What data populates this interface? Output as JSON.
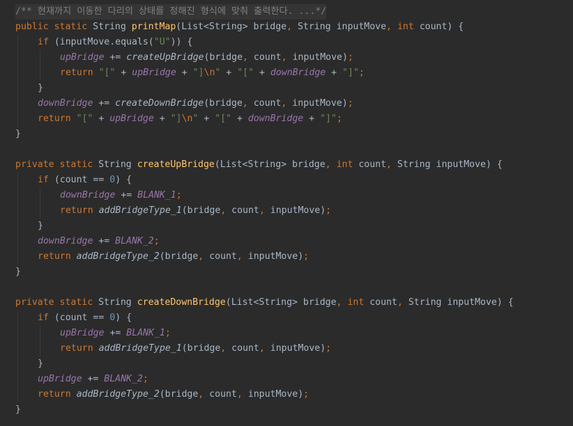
{
  "editor": {
    "language": "java",
    "colors": {
      "background": "#2b2b2b",
      "keyword": "#cc7832",
      "method_declaration": "#ffc66d",
      "field": "#9876aa",
      "string": "#6a8759",
      "number": "#6897bb",
      "comment": "#808080",
      "plain": "#a9b7c6"
    },
    "lines": [
      {
        "indent": 0,
        "tokens": [
          {
            "t": "/** 현재까지 이동한 다리의 상태를 정해진 형식에 맞춰 출력한다. ...*/",
            "c": "cm"
          }
        ]
      },
      {
        "indent": 0,
        "tokens": [
          {
            "t": "public",
            "c": "kw"
          },
          {
            "t": " ",
            "c": "plain"
          },
          {
            "t": "static",
            "c": "kw"
          },
          {
            "t": " String ",
            "c": "plain"
          },
          {
            "t": "printMap",
            "c": "fn"
          },
          {
            "t": "(List<String> bridge",
            "c": "plain"
          },
          {
            "t": ",",
            "c": "kw"
          },
          {
            "t": " String inputMove",
            "c": "plain"
          },
          {
            "t": ",",
            "c": "kw"
          },
          {
            "t": " ",
            "c": "plain"
          },
          {
            "t": "int",
            "c": "kw"
          },
          {
            "t": " count) {",
            "c": "plain"
          }
        ]
      },
      {
        "indent": 1,
        "tokens": [
          {
            "t": "if",
            "c": "kw"
          },
          {
            "t": " (inputMove.equals(",
            "c": "plain"
          },
          {
            "t": "\"U\"",
            "c": "str"
          },
          {
            "t": ")) {",
            "c": "plain"
          }
        ]
      },
      {
        "indent": 2,
        "tokens": [
          {
            "t": "upBridge",
            "c": "field"
          },
          {
            "t": " += ",
            "c": "plain"
          },
          {
            "t": "createUpBridge",
            "c": "call"
          },
          {
            "t": "(bridge",
            "c": "plain"
          },
          {
            "t": ",",
            "c": "kw"
          },
          {
            "t": " count",
            "c": "plain"
          },
          {
            "t": ",",
            "c": "kw"
          },
          {
            "t": " inputMove)",
            "c": "plain"
          },
          {
            "t": ";",
            "c": "kw"
          }
        ]
      },
      {
        "indent": 2,
        "tokens": [
          {
            "t": "return",
            "c": "kw"
          },
          {
            "t": " ",
            "c": "plain"
          },
          {
            "t": "\"[\"",
            "c": "str"
          },
          {
            "t": " + ",
            "c": "plain"
          },
          {
            "t": "upBridge",
            "c": "field"
          },
          {
            "t": " + ",
            "c": "plain"
          },
          {
            "t": "\"]",
            "c": "str"
          },
          {
            "t": "\\n",
            "c": "kw"
          },
          {
            "t": "\"",
            "c": "str"
          },
          {
            "t": " + ",
            "c": "plain"
          },
          {
            "t": "\"[\"",
            "c": "str"
          },
          {
            "t": " + ",
            "c": "plain"
          },
          {
            "t": "downBridge",
            "c": "field"
          },
          {
            "t": " + ",
            "c": "plain"
          },
          {
            "t": "\"]\"",
            "c": "str"
          },
          {
            "t": ";",
            "c": "kw"
          }
        ]
      },
      {
        "indent": 1,
        "tokens": [
          {
            "t": "}",
            "c": "plain"
          }
        ]
      },
      {
        "indent": 1,
        "tokens": [
          {
            "t": "downBridge",
            "c": "field"
          },
          {
            "t": " += ",
            "c": "plain"
          },
          {
            "t": "createDownBridge",
            "c": "call"
          },
          {
            "t": "(bridge",
            "c": "plain"
          },
          {
            "t": ",",
            "c": "kw"
          },
          {
            "t": " count",
            "c": "plain"
          },
          {
            "t": ",",
            "c": "kw"
          },
          {
            "t": " inputMove)",
            "c": "plain"
          },
          {
            "t": ";",
            "c": "kw"
          }
        ]
      },
      {
        "indent": 1,
        "tokens": [
          {
            "t": "return",
            "c": "kw"
          },
          {
            "t": " ",
            "c": "plain"
          },
          {
            "t": "\"[\"",
            "c": "str"
          },
          {
            "t": " + ",
            "c": "plain"
          },
          {
            "t": "upBridge",
            "c": "field"
          },
          {
            "t": " + ",
            "c": "plain"
          },
          {
            "t": "\"]",
            "c": "str"
          },
          {
            "t": "\\n",
            "c": "kw"
          },
          {
            "t": "\"",
            "c": "str"
          },
          {
            "t": " + ",
            "c": "plain"
          },
          {
            "t": "\"[\"",
            "c": "str"
          },
          {
            "t": " + ",
            "c": "plain"
          },
          {
            "t": "downBridge",
            "c": "field"
          },
          {
            "t": " + ",
            "c": "plain"
          },
          {
            "t": "\"]\"",
            "c": "str"
          },
          {
            "t": ";",
            "c": "kw"
          }
        ]
      },
      {
        "indent": 0,
        "tokens": [
          {
            "t": "}",
            "c": "plain"
          }
        ]
      },
      {
        "indent": 0,
        "tokens": []
      },
      {
        "indent": 0,
        "tokens": [
          {
            "t": "private",
            "c": "kw"
          },
          {
            "t": " ",
            "c": "plain"
          },
          {
            "t": "static",
            "c": "kw"
          },
          {
            "t": " String ",
            "c": "plain"
          },
          {
            "t": "createUpBridge",
            "c": "fn"
          },
          {
            "t": "(List<String> bridge",
            "c": "plain"
          },
          {
            "t": ",",
            "c": "kw"
          },
          {
            "t": " ",
            "c": "plain"
          },
          {
            "t": "int",
            "c": "kw"
          },
          {
            "t": " count",
            "c": "plain"
          },
          {
            "t": ",",
            "c": "kw"
          },
          {
            "t": " String inputMove) {",
            "c": "plain"
          }
        ]
      },
      {
        "indent": 1,
        "tokens": [
          {
            "t": "if",
            "c": "kw"
          },
          {
            "t": " (count == ",
            "c": "plain"
          },
          {
            "t": "0",
            "c": "num"
          },
          {
            "t": ") {",
            "c": "plain"
          }
        ]
      },
      {
        "indent": 2,
        "tokens": [
          {
            "t": "downBridge",
            "c": "field"
          },
          {
            "t": " += ",
            "c": "plain"
          },
          {
            "t": "BLANK_1",
            "c": "field"
          },
          {
            "t": ";",
            "c": "kw"
          }
        ]
      },
      {
        "indent": 2,
        "tokens": [
          {
            "t": "return",
            "c": "kw"
          },
          {
            "t": " ",
            "c": "plain"
          },
          {
            "t": "addBridgeType_1",
            "c": "call"
          },
          {
            "t": "(bridge",
            "c": "plain"
          },
          {
            "t": ",",
            "c": "kw"
          },
          {
            "t": " count",
            "c": "plain"
          },
          {
            "t": ",",
            "c": "kw"
          },
          {
            "t": " inputMove)",
            "c": "plain"
          },
          {
            "t": ";",
            "c": "kw"
          }
        ]
      },
      {
        "indent": 1,
        "tokens": [
          {
            "t": "}",
            "c": "plain"
          }
        ]
      },
      {
        "indent": 1,
        "tokens": [
          {
            "t": "downBridge",
            "c": "field"
          },
          {
            "t": " += ",
            "c": "plain"
          },
          {
            "t": "BLANK_2",
            "c": "field"
          },
          {
            "t": ";",
            "c": "kw"
          }
        ]
      },
      {
        "indent": 1,
        "tokens": [
          {
            "t": "return",
            "c": "kw"
          },
          {
            "t": " ",
            "c": "plain"
          },
          {
            "t": "addBridgeType_2",
            "c": "call"
          },
          {
            "t": "(bridge",
            "c": "plain"
          },
          {
            "t": ",",
            "c": "kw"
          },
          {
            "t": " count",
            "c": "plain"
          },
          {
            "t": ",",
            "c": "kw"
          },
          {
            "t": " inputMove)",
            "c": "plain"
          },
          {
            "t": ";",
            "c": "kw"
          }
        ]
      },
      {
        "indent": 0,
        "tokens": [
          {
            "t": "}",
            "c": "plain"
          }
        ]
      },
      {
        "indent": 0,
        "tokens": []
      },
      {
        "indent": 0,
        "tokens": [
          {
            "t": "private",
            "c": "kw"
          },
          {
            "t": " ",
            "c": "plain"
          },
          {
            "t": "static",
            "c": "kw"
          },
          {
            "t": " String ",
            "c": "plain"
          },
          {
            "t": "createDownBridge",
            "c": "fn"
          },
          {
            "t": "(List<String> bridge",
            "c": "plain"
          },
          {
            "t": ",",
            "c": "kw"
          },
          {
            "t": " ",
            "c": "plain"
          },
          {
            "t": "int",
            "c": "kw"
          },
          {
            "t": " count",
            "c": "plain"
          },
          {
            "t": ",",
            "c": "kw"
          },
          {
            "t": " String inputMove) {",
            "c": "plain"
          }
        ]
      },
      {
        "indent": 1,
        "tokens": [
          {
            "t": "if",
            "c": "kw"
          },
          {
            "t": " (count == ",
            "c": "plain"
          },
          {
            "t": "0",
            "c": "num"
          },
          {
            "t": ") {",
            "c": "plain"
          }
        ]
      },
      {
        "indent": 2,
        "tokens": [
          {
            "t": "upBridge",
            "c": "field"
          },
          {
            "t": " += ",
            "c": "plain"
          },
          {
            "t": "BLANK_1",
            "c": "field"
          },
          {
            "t": ";",
            "c": "kw"
          }
        ]
      },
      {
        "indent": 2,
        "tokens": [
          {
            "t": "return",
            "c": "kw"
          },
          {
            "t": " ",
            "c": "plain"
          },
          {
            "t": "addBridgeType_1",
            "c": "call"
          },
          {
            "t": "(bridge",
            "c": "plain"
          },
          {
            "t": ",",
            "c": "kw"
          },
          {
            "t": " count",
            "c": "plain"
          },
          {
            "t": ",",
            "c": "kw"
          },
          {
            "t": " inputMove)",
            "c": "plain"
          },
          {
            "t": ";",
            "c": "kw"
          }
        ]
      },
      {
        "indent": 1,
        "tokens": [
          {
            "t": "}",
            "c": "plain"
          }
        ]
      },
      {
        "indent": 1,
        "tokens": [
          {
            "t": "upBridge",
            "c": "field"
          },
          {
            "t": " += ",
            "c": "plain"
          },
          {
            "t": "BLANK_2",
            "c": "field"
          },
          {
            "t": ";",
            "c": "kw"
          }
        ]
      },
      {
        "indent": 1,
        "tokens": [
          {
            "t": "return",
            "c": "kw"
          },
          {
            "t": " ",
            "c": "plain"
          },
          {
            "t": "addBridgeType_2",
            "c": "call"
          },
          {
            "t": "(bridge",
            "c": "plain"
          },
          {
            "t": ",",
            "c": "kw"
          },
          {
            "t": " count",
            "c": "plain"
          },
          {
            "t": ",",
            "c": "kw"
          },
          {
            "t": " inputMove)",
            "c": "plain"
          },
          {
            "t": ";",
            "c": "kw"
          }
        ]
      },
      {
        "indent": 0,
        "tokens": [
          {
            "t": "}",
            "c": "plain"
          }
        ]
      }
    ]
  }
}
